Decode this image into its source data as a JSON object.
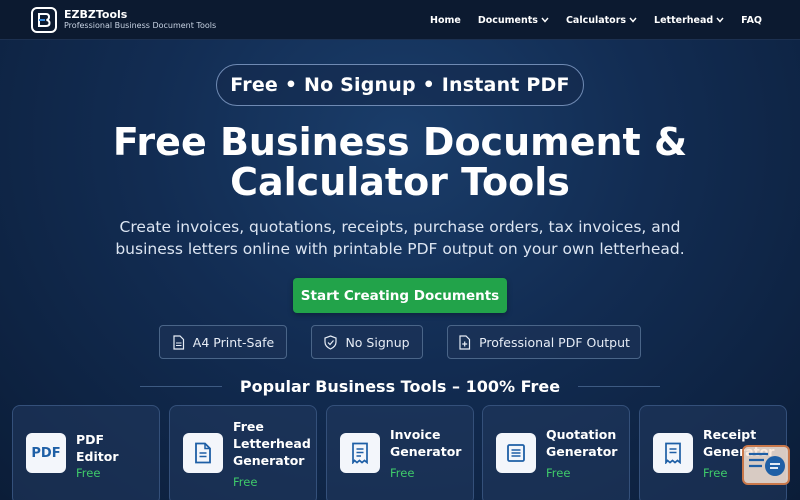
{
  "header": {
    "brand_name": "EZBZTools",
    "brand_tagline": "Professional Business Document Tools",
    "nav": [
      {
        "label": "Home",
        "dropdown": false
      },
      {
        "label": "Documents",
        "dropdown": true
      },
      {
        "label": "Calculators",
        "dropdown": true
      },
      {
        "label": "Letterhead",
        "dropdown": true
      },
      {
        "label": "FAQ",
        "dropdown": false
      }
    ]
  },
  "hero": {
    "pill": "Free • No Signup • Instant PDF",
    "title_line1": "Free Business Document &",
    "title_line2": "Calculator Tools",
    "subtitle_line1": "Create invoices, quotations, receipts, purchase orders, tax invoices, and",
    "subtitle_line2": "business letters online with printable PDF output on your own letterhead.",
    "cta": "Start Creating Documents",
    "features": [
      "A4 Print-Safe",
      "No Signup",
      "Professional PDF Output"
    ]
  },
  "tools": {
    "section_title": "Popular Business Tools – 100% Free",
    "cards": [
      {
        "name_lines": [
          "PDF",
          "Editor"
        ],
        "badge": "Free",
        "icon": "pdf-icon",
        "icon_text": "PDF"
      },
      {
        "name_lines": [
          "Free",
          "Letterhead",
          "Generator"
        ],
        "badge": "Free",
        "icon": "document-icon"
      },
      {
        "name_lines": [
          "Invoice",
          "Generator"
        ],
        "badge": "Free",
        "icon": "invoice-icon"
      },
      {
        "name_lines": [
          "Quotation",
          "Generator"
        ],
        "badge": "Free",
        "icon": "quotation-icon"
      },
      {
        "name_lines": [
          "Receipt",
          "Generator"
        ],
        "badge": "Free",
        "icon": "receipt-icon"
      }
    ]
  },
  "colors": {
    "cta_green": "#22a34a",
    "free_green": "#3fcb6a",
    "icon_blue": "#1e5fa6"
  }
}
